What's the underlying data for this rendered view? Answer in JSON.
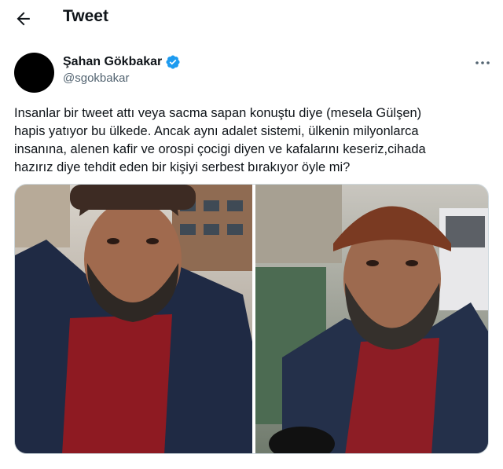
{
  "header": {
    "title": "Tweet",
    "back_icon": "arrow-left-icon"
  },
  "author": {
    "name": "Şahan Gökbakar",
    "handle": "@sgokbakar",
    "verified_icon": "verified-badge-icon",
    "verified_color": "#1d9bf0"
  },
  "more_icon": "more-horizontal-icon",
  "tweet": {
    "lines": [
      "Insanlar bir tweet attı veya sacma sapan konuştu diye (mesela Gülşen)",
      "hapis yatıyor bu ülkede. Ancak aynı adalet sistemi, ülkenin milyonlarca",
      "insanına, alenen kafir ve orospi çocigi diyen ve kafalarını keseriz,cihada",
      "hazırız diye tehdit eden bir kişiyi serbest bırakıyor öyle mi?"
    ]
  },
  "media": {
    "panels": [
      "photo-left",
      "photo-right"
    ]
  }
}
